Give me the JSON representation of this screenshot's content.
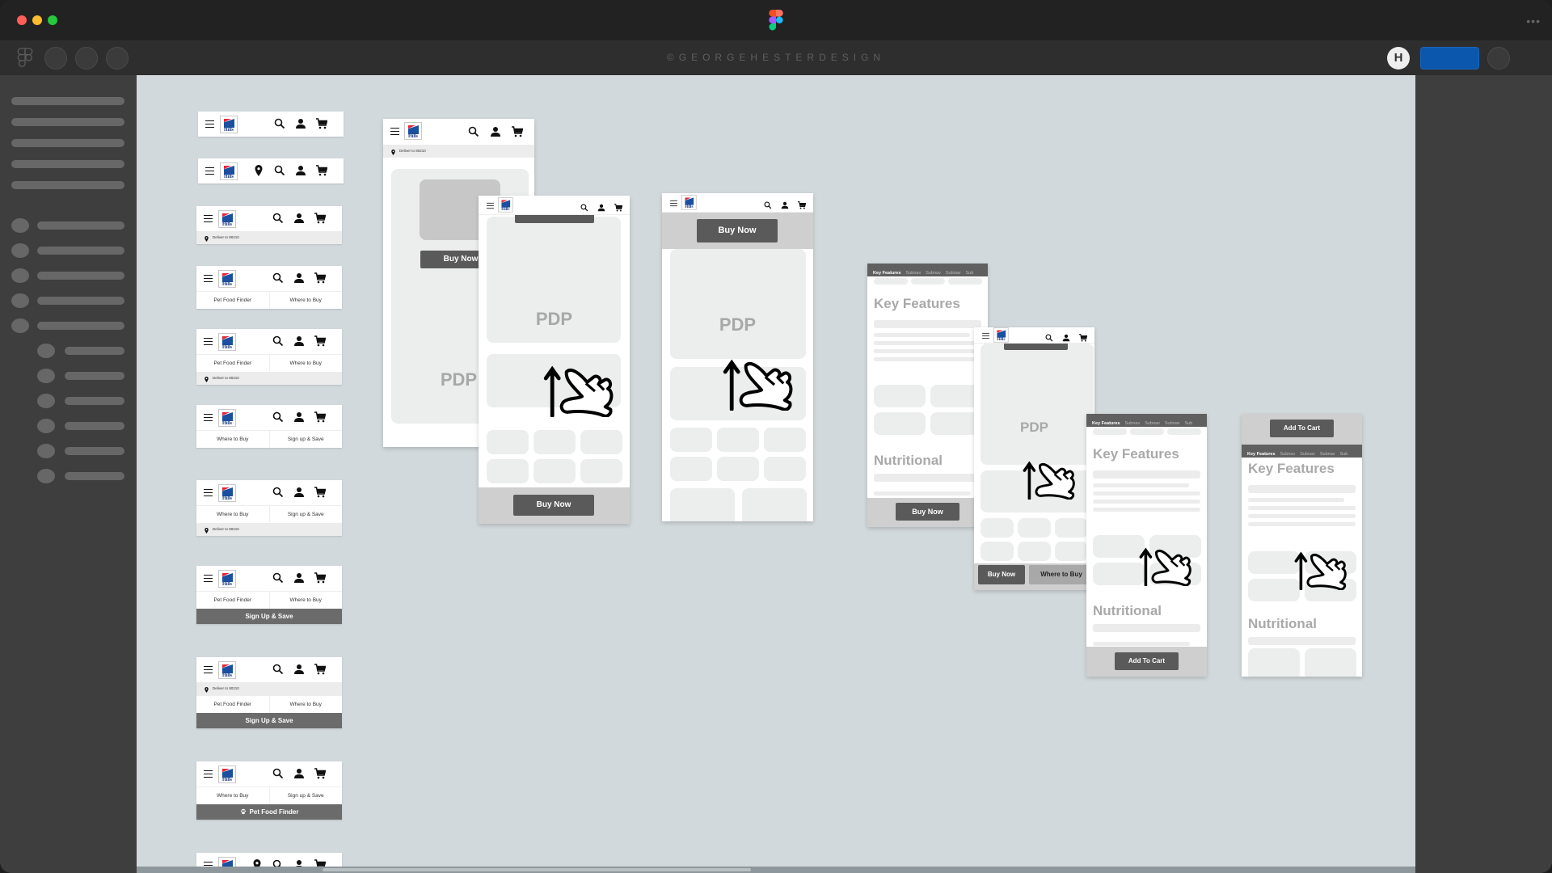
{
  "window": {
    "traffic_lights": {
      "close": "#ff5f57",
      "minimize": "#febc2e",
      "maximize": "#28c840"
    },
    "app_logo": "figma-logo-icon",
    "more_icon": "more-horizontal-icon"
  },
  "toolbar": {
    "brand_text": "©GEORGEHESTERDESIGN",
    "avatar_letter": "H",
    "share_button_color": "#0b57ad"
  },
  "colors": {
    "canvas_bg": "#d2d9dc",
    "panel_bg": "#3e3e3e",
    "button_dark": "#5a5a5a",
    "cta_bar": "#6b6b6b",
    "logo_blue": "#1b4fa0",
    "logo_red": "#e0283a"
  },
  "headers": {
    "logo_text": "Hills",
    "deliver_text": "Deliver to 90210",
    "pet_food_finder": "Pet Food Finder",
    "where_to_buy": "Where to Buy",
    "sign_up_save_small": "Sign up & Save",
    "sign_up_save_cta": "Sign Up & Save",
    "pet_food_finder_cta": "Pet Food Finder"
  },
  "pdp": {
    "placeholder_label": "PDP",
    "buy_now": "Buy Now",
    "where_to_buy": "Where to Buy",
    "add_to_cart": "Add To Cart",
    "key_features": "Key Features",
    "nutritional": "Nutritional",
    "subnav": [
      "Key Features",
      "Subnav",
      "Subnav",
      "Subnav",
      "Sub"
    ]
  }
}
